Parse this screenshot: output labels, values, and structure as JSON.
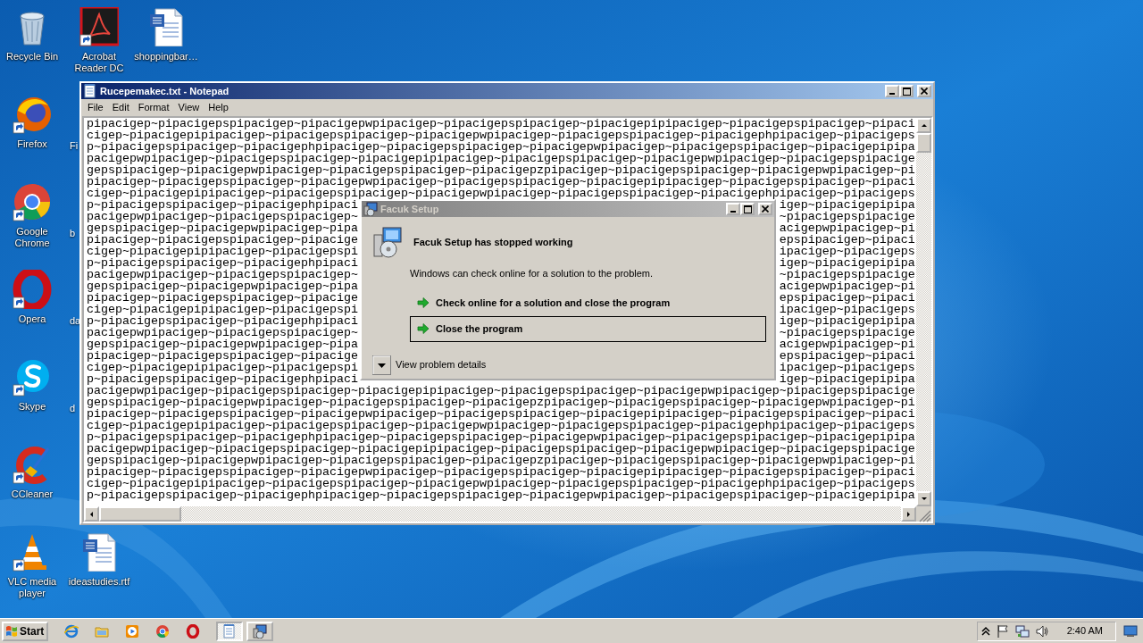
{
  "desktop_icons": [
    {
      "label": "Recycle Bin",
      "kind": "trash",
      "shortcut": false
    },
    {
      "label": "Acrobat Reader DC",
      "kind": "acrobat",
      "shortcut": true
    },
    {
      "label": "shoppingbar…",
      "kind": "document",
      "shortcut": false
    },
    {
      "label": "Firefox",
      "kind": "firefox",
      "shortcut": true
    },
    {
      "label": "Fi",
      "kind": "hidden"
    },
    {
      "label": "Google Chrome",
      "kind": "chrome",
      "shortcut": true
    },
    {
      "label": "b",
      "kind": "hidden"
    },
    {
      "label": "Opera",
      "kind": "opera",
      "shortcut": true
    },
    {
      "label": "da",
      "kind": "hidden"
    },
    {
      "label": "Skype",
      "kind": "skype",
      "shortcut": true
    },
    {
      "label": "d",
      "kind": "hidden"
    },
    {
      "label": "CCleaner",
      "kind": "ccleaner",
      "shortcut": true
    },
    {
      "label": "VLC media player",
      "kind": "vlc",
      "shortcut": true
    },
    {
      "label": "ideastudies.rtf",
      "kind": "document",
      "shortcut": false
    }
  ],
  "notepad": {
    "title": "Rucepemakec.txt - Notepad",
    "menu": [
      "File",
      "Edit",
      "Format",
      "View",
      "Help"
    ],
    "lines": [
      {
        "parts": [
          "pipacigep~pipacigepspipacigep~pipacigepwpipacigep~pipacigepspipacigep~pipacigepipipacigep~pipacigepspipacigep~pipaci"
        ]
      },
      {
        "parts": [
          "cigep~pipacigepipipacigep~pipacigepspipacigep~pipacigepwpipacigep~pipacigepspipacigep~pipacigephpipacigep~pipacigeps"
        ]
      },
      {
        "parts": [
          "p~pipacigepspipacigep~pipacigephpipacigep~pipacigepspipacigep~pipacigepwpipacigep~pipacigepspipacigep~pipacigepipipa"
        ]
      },
      {
        "parts": [
          "pacigepwpipacigep~pipacigepspipacigep~pipacigepipipacigep~pipacigepspipacigep~pipacigepwpipacigep~pipacigepspipacige"
        ]
      },
      {
        "parts": [
          "gepspipacigep~pipacigepwpipacigep~pipacigepspipacigep~pipacigepzpipacigep~pipacigepspipacigep~pipacigepwpipacigep~pi"
        ]
      },
      {
        "parts": [
          "pipacigep~pipacigepspipacigep~pipacigepwpipacigep~pipacigepspipacigep~pipacigepipipacigep~pipacigepspipacigep~pipaci"
        ]
      },
      {
        "parts": [
          "cigep~pipacigepipipacigep~pipacigepspipacigep~pipacigepwpipacigep~pipacigepspipacigep~pipacigephpipacigep~pipacigeps"
        ]
      },
      {
        "parts": [
          "p~pipacigepspipacigep~pipacigephpipaci",
          "igep~pipacigepipipa"
        ]
      },
      {
        "parts": [
          "pacigepwpipacigep~pipacigepspipacigep~",
          "~pipacigepspipacige"
        ]
      },
      {
        "parts": [
          "gepspipacigep~pipacigepwpipacigep~pipa",
          "acigepwpipacigep~pi"
        ]
      },
      {
        "parts": [
          "pipacigep~pipacigepspipacigep~pipacige",
          "epspipacigep~pipaci"
        ]
      },
      {
        "parts": [
          "cigep~pipacigepipipacigep~pipacigepspi",
          "ipacigep~pipacigeps"
        ]
      },
      {
        "parts": [
          "p~pipacigepspipacigep~pipacigephpipaci",
          "igep~pipacigepipipa"
        ]
      },
      {
        "parts": [
          "pacigepwpipacigep~pipacigepspipacigep~",
          "~pipacigepspipacige"
        ]
      },
      {
        "parts": [
          "gepspipacigep~pipacigepwpipacigep~pipa",
          "acigepwpipacigep~pi"
        ]
      },
      {
        "parts": [
          "pipacigep~pipacigepspipacigep~pipacige",
          "epspipacigep~pipaci"
        ]
      },
      {
        "parts": [
          "cigep~pipacigepipipacigep~pipacigepspi",
          "ipacigep~pipacigeps"
        ]
      },
      {
        "parts": [
          "p~pipacigepspipacigep~pipacigephpipaci",
          "igep~pipacigepipipa"
        ]
      },
      {
        "parts": [
          "pacigepwpipacigep~pipacigepspipacigep~",
          "~pipacigepspipacige"
        ]
      },
      {
        "parts": [
          "gepspipacigep~pipacigepwpipacigep~pipa",
          "acigepwpipacigep~pi"
        ]
      },
      {
        "parts": [
          "pipacigep~pipacigepspipacigep~pipacige",
          "epspipacigep~pipaci"
        ]
      },
      {
        "parts": [
          "cigep~pipacigepipipacigep~pipacigepspi",
          "ipacigep~pipacigeps"
        ]
      },
      {
        "parts": [
          "p~pipacigepspipacigep~pipacigephpipaci",
          "igep~pipacigepipipa"
        ]
      },
      {
        "parts": [
          "pacigepwpipacigep~pipacigepspipacigep~pipacigepipipacigep~pipacigepspipacigep~pipacigepwpipacigep~pipacigepspipacige"
        ]
      },
      {
        "parts": [
          "gepspipacigep~pipacigepwpipacigep~pipacigepspipacigep~pipacigepzpipacigep~pipacigepspipacigep~pipacigepwpipacigep~pi"
        ]
      },
      {
        "parts": [
          "pipacigep~pipacigepspipacigep~pipacigepwpipacigep~pipacigepspipacigep~pipacigepipipacigep~pipacigepspipacigep~pipaci"
        ]
      },
      {
        "parts": [
          "cigep~pipacigepipipacigep~pipacigepspipacigep~pipacigepwpipacigep~pipacigepspipacigep~pipacigephpipacigep~pipacigeps"
        ]
      },
      {
        "parts": [
          "p~pipacigepspipacigep~pipacigephpipacigep~pipacigepspipacigep~pipacigepwpipacigep~pipacigepspipacigep~pipacigepipipa"
        ]
      },
      {
        "parts": [
          "pacigepwpipacigep~pipacigepspipacigep~pipacigepipipacigep~pipacigepspipacigep~pipacigepwpipacigep~pipacigepspipacige"
        ]
      },
      {
        "parts": [
          "gepspipacigep~pipacigepwpipacigep~pipacigepspipacigep~pipacigepzpipacigep~pipacigepspipacigep~pipacigepwpipacigep~pi"
        ]
      },
      {
        "parts": [
          "pipacigep~pipacigepspipacigep~pipacigepwpipacigep~pipacigepspipacigep~pipacigepipipacigep~pipacigepspipacigep~pipaci"
        ]
      },
      {
        "parts": [
          "cigep~pipacigepipipacigep~pipacigepspipacigep~pipacigepwpipacigep~pipacigepspipacigep~pipacigephpipacigep~pipacigeps"
        ]
      },
      {
        "parts": [
          "p~pipacigepspipacigep~pipacigephpipacigep~pipacigepspipacigep~pipacigepwpipacigep~pipacigepspipacigep~pipacigepipipa"
        ]
      }
    ]
  },
  "dialog": {
    "title": "Facuk Setup",
    "heading": "Facuk Setup has stopped working",
    "message": "Windows can check online for a solution to the problem.",
    "options": [
      {
        "label": "Check online for a solution and close the program",
        "focused": false
      },
      {
        "label": "Close the program",
        "focused": true
      }
    ],
    "details": "View problem details"
  },
  "taskbar": {
    "start": "Start",
    "tasks": [
      {
        "kind": "notepad",
        "active": true
      },
      {
        "kind": "setup",
        "active": false
      }
    ],
    "clock": "2:40 AM"
  }
}
